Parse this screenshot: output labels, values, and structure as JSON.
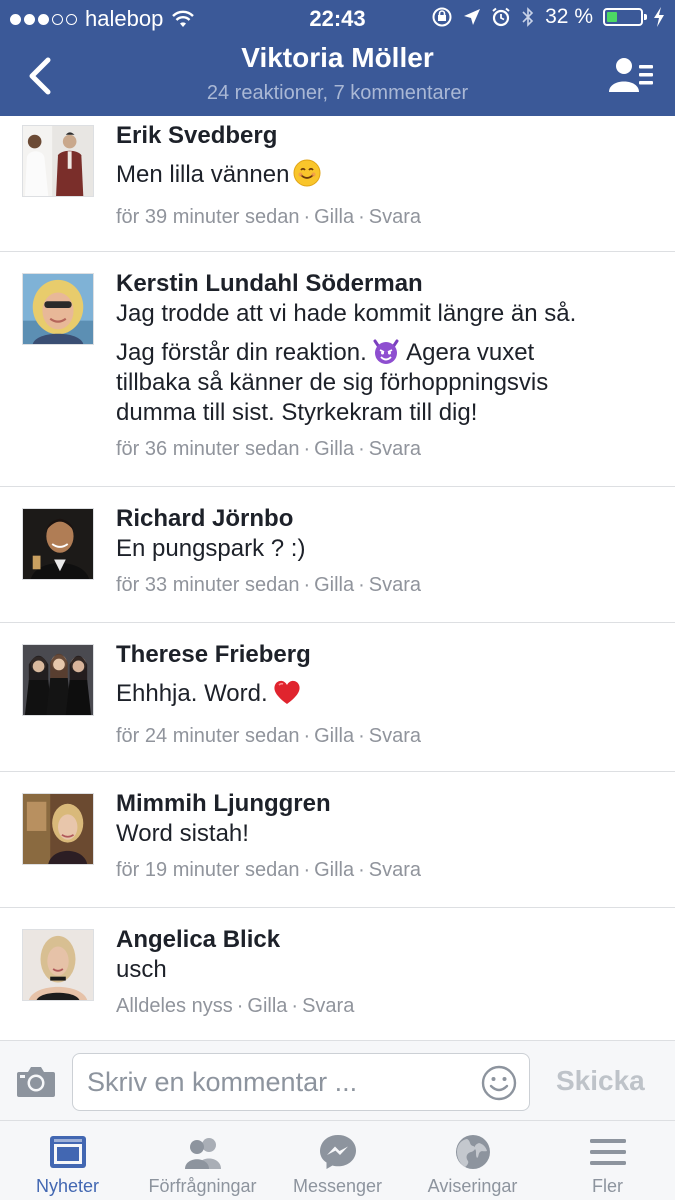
{
  "status_bar": {
    "carrier": "halebop",
    "time": "22:43",
    "battery_percent": "32 %",
    "battery_level": 0.32
  },
  "nav": {
    "title": "Viktoria Möller",
    "subtitle": "24 reaktioner, 7 kommentarer"
  },
  "comments": [
    {
      "name": "Erik Svedberg",
      "text": [
        "Men lilla vännen"
      ],
      "emoji": "smiling-face-emoji",
      "time": "för 39 minuter sedan",
      "like": "Gilla",
      "reply": "Svara"
    },
    {
      "name": "Kerstin Lundahl Söderman",
      "text": [
        "Jag trodde att vi hade kommit längre än så.",
        "Jag förstår din reaktion.",
        "Agera vuxet",
        "tillbaka så känner de sig förhoppningsvis",
        "dumma till sist. Styrkekram till dig!"
      ],
      "emoji": "devil-face-emoji",
      "time": "för 36 minuter sedan",
      "like": "Gilla",
      "reply": "Svara"
    },
    {
      "name": "Richard Jörnbo",
      "text": [
        "En pungspark ? :)"
      ],
      "time": "för 33 minuter sedan",
      "like": "Gilla",
      "reply": "Svara"
    },
    {
      "name": "Therese Frieberg",
      "text": [
        "Ehhhja. Word."
      ],
      "emoji": "red-heart-emoji",
      "time": "för 24 minuter sedan",
      "like": "Gilla",
      "reply": "Svara"
    },
    {
      "name": "Mimmih Ljunggren",
      "text": [
        "Word sistah!"
      ],
      "time": "för 19 minuter sedan",
      "like": "Gilla",
      "reply": "Svara"
    },
    {
      "name": "Angelica Blick",
      "text": [
        "usch"
      ],
      "time": "Alldeles nyss",
      "like": "Gilla",
      "reply": "Svara"
    }
  ],
  "composer": {
    "placeholder": "Skriv en kommentar ...",
    "send_label": "Skicka"
  },
  "tabs": [
    {
      "label": "Nyheter",
      "icon": "news-feed-icon",
      "active": true
    },
    {
      "label": "Förfrågningar",
      "icon": "friend-requests-icon",
      "active": false
    },
    {
      "label": "Messenger",
      "icon": "messenger-icon",
      "active": false
    },
    {
      "label": "Aviseringar",
      "icon": "globe-icon",
      "active": false
    },
    {
      "label": "Fler",
      "icon": "menu-icon",
      "active": false
    }
  ],
  "colors": {
    "brand": "#3b5998",
    "active_tab": "#4267b2",
    "meta_text": "#90949c"
  }
}
